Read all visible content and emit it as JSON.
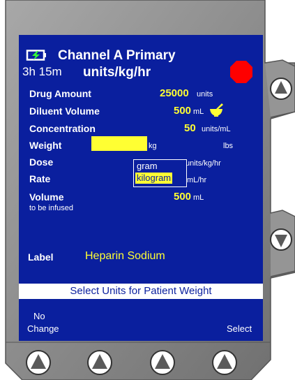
{
  "header": {
    "channel_title": "Channel A Primary",
    "time_remaining": "3h 15m",
    "dose_units_title": "units/kg/hr",
    "battery_icon": "battery-charging-icon",
    "stop_icon": "stop-octagon-icon",
    "stop_color": "#ff0000"
  },
  "fields": {
    "drug_amount": {
      "label": "Drug Amount",
      "value": "25000",
      "unit": "units"
    },
    "diluent_volume": {
      "label": "Diluent Volume",
      "value": "500",
      "unit": "mL",
      "icon": "mortar-pestle-icon"
    },
    "concentration": {
      "label": "Concentration",
      "value": "50",
      "unit": "units/mL"
    },
    "weight": {
      "label": "Weight",
      "value": "",
      "unit_kg": "kg",
      "unit_lbs": "lbs"
    },
    "dose": {
      "label": "Dose",
      "unit": "units/kg/hr"
    },
    "rate": {
      "label": "Rate",
      "unit": "mL/hr"
    },
    "volume": {
      "label": "Volume",
      "sublabel": "to be infused",
      "value": "500",
      "unit": "mL"
    }
  },
  "unit_dropdown": {
    "options": [
      "gram",
      "kilogram"
    ],
    "selected": "kilogram"
  },
  "drug_label": {
    "label": "Label",
    "value": "Heparin Sodium"
  },
  "prompt": "Select Units for Patient Weight",
  "softkeys": {
    "left_line1": "No",
    "left_line2": "Change",
    "right": "Select"
  },
  "colors": {
    "screen_bg": "#0a1f9e",
    "highlight": "#ffff33",
    "bezel": "#8a8a8a"
  }
}
